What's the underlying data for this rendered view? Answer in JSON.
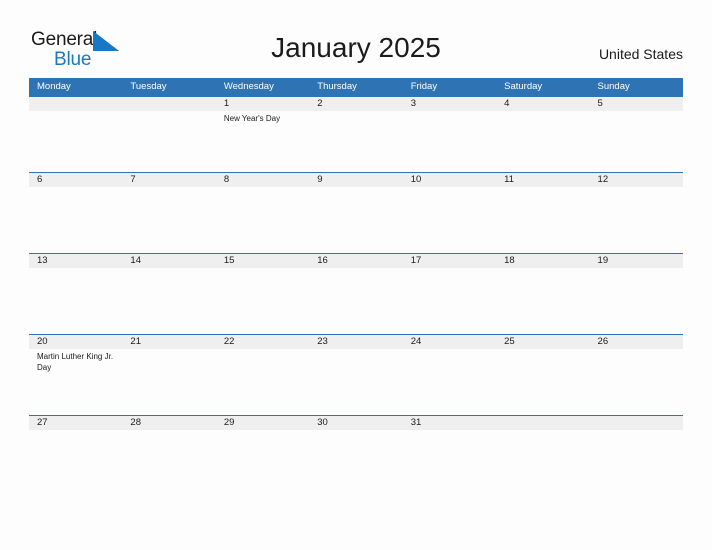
{
  "brand": {
    "name_part1": "General",
    "name_part2": "Blue",
    "flag_icon": "flag-triangle-icon",
    "accent_color": "#1878c4"
  },
  "header": {
    "title": "January 2025",
    "country": "United States"
  },
  "theme": {
    "header_blue": "#2e74b5",
    "date_band_gray": "#efefef",
    "page_background": "#fdfdfd",
    "text_color": "#1b1b1b"
  },
  "calendar": {
    "month": "January",
    "year": "2025",
    "weekday_headers": [
      "Monday",
      "Tuesday",
      "Wednesday",
      "Thursday",
      "Friday",
      "Saturday",
      "Sunday"
    ],
    "weeks": [
      [
        {
          "day": "",
          "event": ""
        },
        {
          "day": "",
          "event": ""
        },
        {
          "day": "1",
          "event": "New Year's Day"
        },
        {
          "day": "2",
          "event": ""
        },
        {
          "day": "3",
          "event": ""
        },
        {
          "day": "4",
          "event": ""
        },
        {
          "day": "5",
          "event": ""
        }
      ],
      [
        {
          "day": "6",
          "event": ""
        },
        {
          "day": "7",
          "event": ""
        },
        {
          "day": "8",
          "event": ""
        },
        {
          "day": "9",
          "event": ""
        },
        {
          "day": "10",
          "event": ""
        },
        {
          "day": "11",
          "event": ""
        },
        {
          "day": "12",
          "event": ""
        }
      ],
      [
        {
          "day": "13",
          "event": ""
        },
        {
          "day": "14",
          "event": ""
        },
        {
          "day": "15",
          "event": ""
        },
        {
          "day": "16",
          "event": ""
        },
        {
          "day": "17",
          "event": ""
        },
        {
          "day": "18",
          "event": ""
        },
        {
          "day": "19",
          "event": ""
        }
      ],
      [
        {
          "day": "20",
          "event": "Martin Luther King Jr. Day"
        },
        {
          "day": "21",
          "event": ""
        },
        {
          "day": "22",
          "event": ""
        },
        {
          "day": "23",
          "event": ""
        },
        {
          "day": "24",
          "event": ""
        },
        {
          "day": "25",
          "event": ""
        },
        {
          "day": "26",
          "event": ""
        }
      ],
      [
        {
          "day": "27",
          "event": ""
        },
        {
          "day": "28",
          "event": ""
        },
        {
          "day": "29",
          "event": ""
        },
        {
          "day": "30",
          "event": ""
        },
        {
          "day": "31",
          "event": ""
        },
        {
          "day": "",
          "event": ""
        },
        {
          "day": "",
          "event": ""
        }
      ]
    ]
  }
}
